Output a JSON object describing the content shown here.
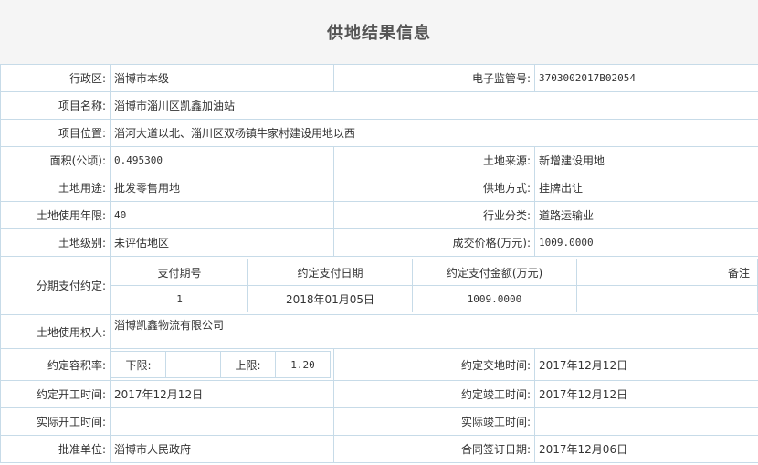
{
  "page": {
    "title": "供地结果信息"
  },
  "rows": {
    "region_label": "行政区:",
    "region_value": "淄博市本级",
    "supervision_label": "电子监管号:",
    "supervision_value": "3703002017B02054",
    "project_name_label": "项目名称:",
    "project_name_value": "淄博市淄川区凯鑫加油站",
    "project_location_label": "项目位置:",
    "project_location_value": "淄河大道以北、淄川区双杨镇牛家村建设用地以西",
    "area_label": "面积(公顷):",
    "area_value": "0.495300",
    "land_source_label": "土地来源:",
    "land_source_value": "新增建设用地",
    "land_use_label": "土地用途:",
    "land_use_value": "批发零售用地",
    "supply_method_label": "供地方式:",
    "supply_method_value": "挂牌出让",
    "use_years_label": "土地使用年限:",
    "use_years_value": "40",
    "industry_label": "行业分类:",
    "industry_value": "道路运输业",
    "land_level_label": "土地级别:",
    "land_level_value": "未评估地区",
    "deal_price_label": "成交价格(万元):",
    "deal_price_value": "1009.0000",
    "installment_label": "分期支付约定:",
    "installment": {
      "headers": [
        "支付期号",
        "约定支付日期",
        "约定支付金额(万元)",
        "备注"
      ],
      "row": [
        "1",
        "2018年01月05日",
        "1009.0000",
        ""
      ]
    },
    "land_user_label": "土地使用权人:",
    "land_user_value": "淄博凯鑫物流有限公司",
    "far_label": "约定容积率:",
    "far_lower_label": "下限:",
    "far_lower_value": "",
    "far_upper_label": "上限:",
    "far_upper_value": "1.20",
    "handover_label": "约定交地时间:",
    "handover_value": "2017年12月12日",
    "start_label": "约定开工时间:",
    "start_value": "2017年12月12日",
    "complete_label": "约定竣工时间:",
    "complete_value": "2017年12月12日",
    "actual_start_label": "实际开工时间:",
    "actual_start_value": "",
    "actual_complete_label": "实际竣工时间:",
    "actual_complete_value": "",
    "approver_label": "批准单位:",
    "approver_value": "淄博市人民政府",
    "contract_date_label": "合同签订日期:",
    "contract_date_value": "2017年12月06日"
  }
}
